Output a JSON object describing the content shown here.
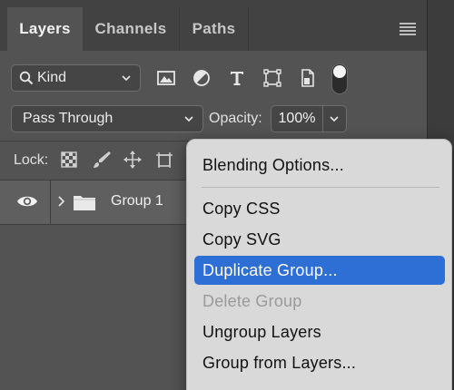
{
  "tabs": [
    {
      "label": "Layers",
      "active": true
    },
    {
      "label": "Channels",
      "active": false
    },
    {
      "label": "Paths",
      "active": false
    }
  ],
  "filter": {
    "kind_label": "Kind",
    "icons": [
      "image-filter-icon",
      "adjustment-filter-icon",
      "type-filter-icon",
      "shape-filter-icon",
      "smart-object-filter-icon"
    ]
  },
  "blend": {
    "mode": "Pass Through",
    "opacity_label": "Opacity:",
    "opacity_value": "100%"
  },
  "lock": {
    "label": "Lock:",
    "icons": [
      "lock-transparency-icon",
      "lock-pixels-icon",
      "lock-position-icon",
      "lock-artboard-icon"
    ]
  },
  "layer": {
    "name": "Group 1"
  },
  "context_menu": {
    "items": [
      {
        "label": "Blending Options...",
        "state": "normal"
      },
      {
        "label": "Copy CSS",
        "state": "normal"
      },
      {
        "label": "Copy SVG",
        "state": "normal"
      },
      {
        "label": "Duplicate Group...",
        "state": "highlighted"
      },
      {
        "label": "Delete Group",
        "state": "disabled"
      },
      {
        "label": "Ungroup Layers",
        "state": "normal"
      },
      {
        "label": "Group from Layers...",
        "state": "normal"
      }
    ]
  },
  "colors": {
    "panel_bg": "#535353",
    "tab_bar_bg": "#424242",
    "menu_bg": "#d9d9d9",
    "menu_highlight": "#2e6fd6",
    "selected_row_bg": "#5f5f5f"
  }
}
